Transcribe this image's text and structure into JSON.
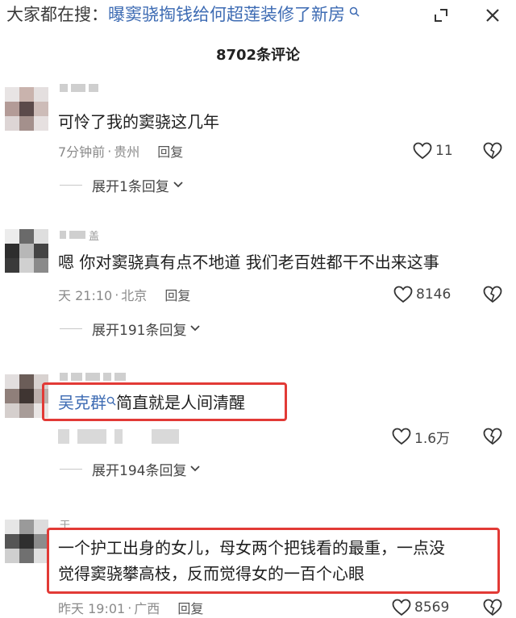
{
  "search_hint": {
    "prefix": "大家都在搜：",
    "query": "曝窦骁掏钱给何超莲装修了新房"
  },
  "header": {
    "comment_count": "8702条评论"
  },
  "comments": [
    {
      "content": "可怜了我的窦骁这几年",
      "time": "7分钟前",
      "location": "贵州",
      "reply_label": "回复",
      "likes": "11",
      "expand_label": "展开1条回复"
    },
    {
      "username": "盖",
      "content": "嗯 你对窦骁真有点不地道 我们老百姓都干不出来这事",
      "time": "天 21:10",
      "location": "北京",
      "reply_label": "回复",
      "likes": "8146",
      "expand_label": "展开191条回复"
    },
    {
      "mention": "吴克群",
      "content": "简直就是人间清醒",
      "likes": "1.6万",
      "expand_label": "展开194条回复"
    },
    {
      "username": "干",
      "content_line1": "一个护工出身的女儿，母女两个把钱看的最重，一点没",
      "content_line2": "觉得窦骁攀高枝，反而觉得女的一百个心眼",
      "time": "昨天 19:01",
      "location": "广西",
      "reply_label": "回复",
      "likes": "8569"
    }
  ],
  "meta_separator": "·",
  "colors": {
    "highlight_box": "#e23a36",
    "link": "#3d6bb3"
  }
}
